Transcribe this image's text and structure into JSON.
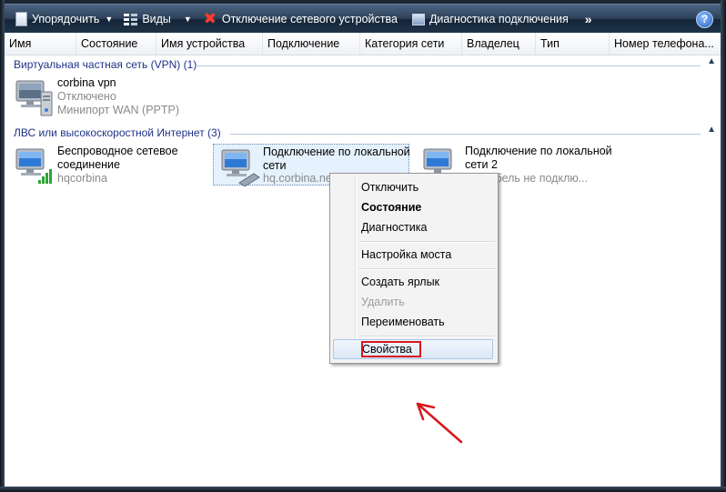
{
  "toolbar": {
    "organize_label": "Упорядочить",
    "views_label": "Виды",
    "disconnect_label": "Отключение сетевого устройства",
    "diagnose_label": "Диагностика подключения",
    "more_label": "»",
    "help_label": "?"
  },
  "columns": [
    "Имя",
    "Состояние",
    "Имя устройства",
    "Подключение",
    "Категория сети",
    "Владелец",
    "Тип",
    "Номер телефона..."
  ],
  "groups": {
    "vpn": {
      "label": "Виртуальная частная сеть (VPN) (1)",
      "items": [
        {
          "name": "corbina vpn",
          "status": "Отключено",
          "device": "Минипорт WAN (PPTP)"
        }
      ]
    },
    "lan": {
      "label": "ЛВС или высокоскоростной Интернет (3)",
      "items": [
        {
          "name_line1": "Беспроводное сетевое",
          "name_line2": "соединение",
          "network": "hqcorbina"
        },
        {
          "name_line1": "Подключение по локальной",
          "name_line2": "сети",
          "network": "hq.corbina.ne"
        },
        {
          "name_line1": "Подключение по локальной",
          "name_line2": "сети 2",
          "network": "...й кабель не подклю..."
        }
      ]
    }
  },
  "context_menu": {
    "items": [
      "Отключить",
      "Состояние",
      "Диагностика",
      "Настройка моста",
      "Создать ярлык",
      "Удалить",
      "Переименовать",
      "Свойства"
    ],
    "bold_item": "Состояние",
    "disabled_item": "Удалить",
    "highlighted_item": "Свойства"
  },
  "colors": {
    "group_text": "#1e3287",
    "annotation": "#d8171c",
    "selection": "#e5f1fc"
  },
  "icons": [
    "document-icon",
    "views-icon",
    "disconnect-x-icon",
    "diagnostics-icon",
    "help-icon",
    "vpn-computer-icon",
    "wireless-computer-icon",
    "lan-computer-icon",
    "lan-unplugged-icon",
    "collapse-chevron-icon",
    "red-arrow-annotation"
  ]
}
